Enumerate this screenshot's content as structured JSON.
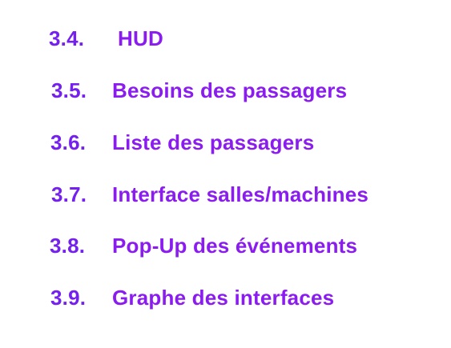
{
  "colors": {
    "number": "#7420ee",
    "title": "#8a1cf0",
    "background": "#ffffff"
  },
  "toc": {
    "items": [
      {
        "number": "3.4.",
        "title": "HUD"
      },
      {
        "number": "3.5.",
        "title": "Besoins des passagers"
      },
      {
        "number": "3.6.",
        "title": "Liste des passagers"
      },
      {
        "number": "3.7.",
        "title": "Interface salles/machines"
      },
      {
        "number": "3.8.",
        "title": "Pop-Up des événements"
      },
      {
        "number": "3.9.",
        "title": "Graphe des interfaces"
      }
    ]
  }
}
